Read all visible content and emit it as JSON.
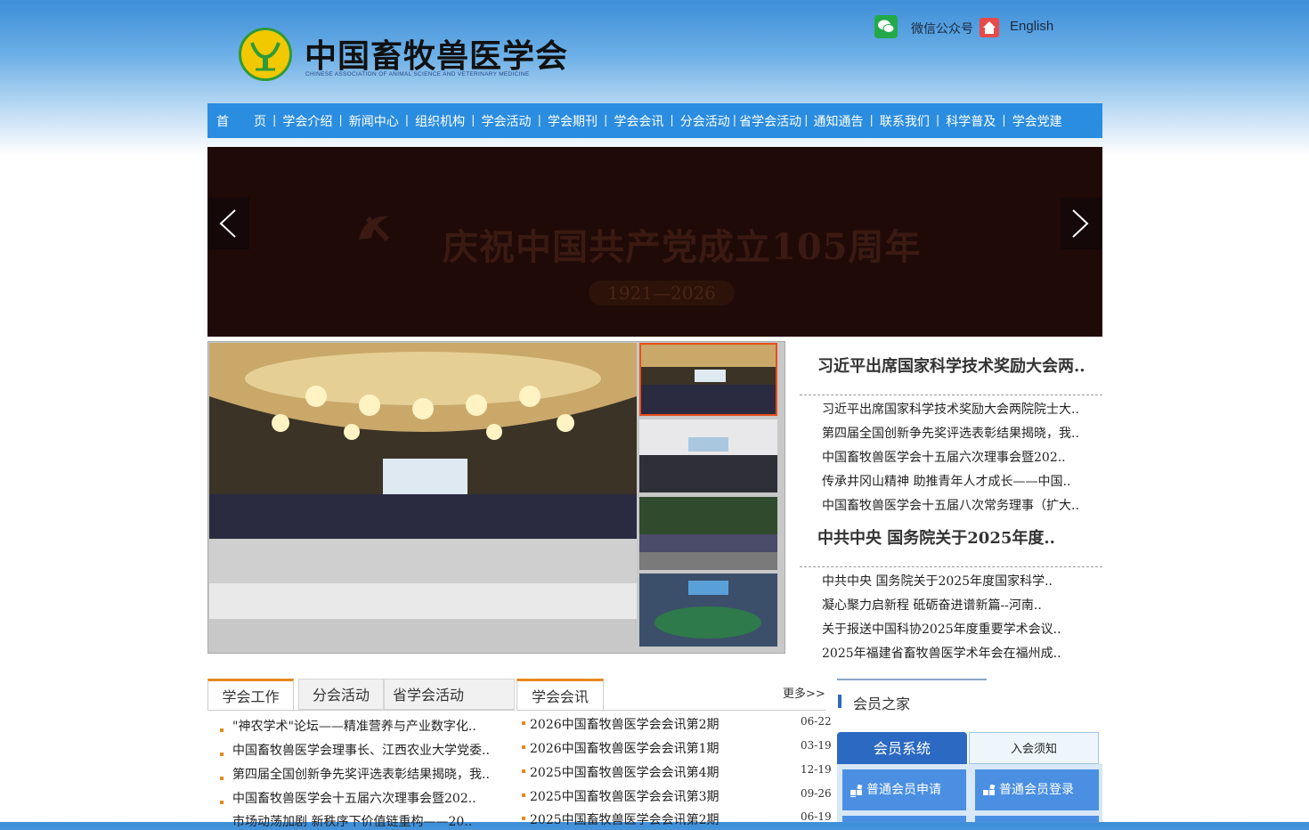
{
  "header": {
    "logo_cn": "中国畜牧兽医学会",
    "logo_en": "CHINESE ASSOCIATION OF ANIMAL SCIENCE AND VETERINARY MEDICINE",
    "wechat_label": "微信公众号",
    "english_label": "English",
    "icons": {
      "wechat": "wechat-icon",
      "home": "home-icon"
    }
  },
  "nav": {
    "items": [
      "首　　页",
      "学会介绍",
      "新闻中心",
      "组织机构",
      "学会活动",
      "学会期刊",
      "学会会讯",
      "分会活动",
      "省学会活动",
      "通知通告",
      "联系我们",
      "科学普及",
      "学会党建"
    ]
  },
  "banner": {
    "title": "庆祝中国共产党成立105周年",
    "years": "1921—2026",
    "icons": {
      "prev": "chevron-left-icon",
      "next": "chevron-right-icon"
    }
  },
  "news": {
    "groups": [
      {
        "headline": "习近平出席国家科学技术奖励大会两..",
        "items": [
          "习近平出席国家科学技术奖励大会两院院士大..",
          "第四届全国创新争先奖评选表彰结果揭晓，我..",
          "中国畜牧兽医学会十五届六次理事会暨202..",
          "传承井冈山精神 助推青年人才成长——中国..",
          "中国畜牧兽医学会十五届八次常务理事（扩大.."
        ]
      },
      {
        "headline": "中共中央 国务院关于2025年度..",
        "items": [
          "中共中央 国务院关于2025年度国家科学..",
          "凝心聚力启新程 砥砺奋进谱新篇--河南..",
          "关于报送中国科协2025年度重要学术会议..",
          "2025年福建省畜牧兽医学术年会在福州成.."
        ]
      }
    ]
  },
  "work": {
    "tabs": [
      "学会工作",
      "分会活动",
      "省学会活动"
    ],
    "items": [
      "\"神农学术\"论坛——精准营养与产业数字化..",
      "中国畜牧兽医学会理事长、江西农业大学党委..",
      "第四届全国创新争先奖评选表彰结果揭晓，我..",
      "中国畜牧兽医学会十五届六次理事会暨202..",
      "市场动荡加剧 新秩序下价值链重构——20.."
    ]
  },
  "newsletter": {
    "tab": "学会会讯",
    "more": "更多>>",
    "items": [
      {
        "title": "2026中国畜牧兽医学会会讯第2期",
        "date": "06-22"
      },
      {
        "title": "2026中国畜牧兽医学会会讯第1期",
        "date": "03-19"
      },
      {
        "title": "2025中国畜牧兽医学会会讯第4期",
        "date": "12-19"
      },
      {
        "title": "2025中国畜牧兽医学会会讯第3期",
        "date": "09-26"
      },
      {
        "title": "2025中国畜牧兽医学会会讯第2期",
        "date": "06-19"
      }
    ]
  },
  "member": {
    "title": "会员之家",
    "tab_system": "会员系统",
    "tab_notice": "入会须知",
    "btn_apply": "普通会员申请",
    "btn_login": "普通会员登录"
  },
  "colors": {
    "nav": "#2b8de0",
    "accent": "#e8891d",
    "member_blue": "#2b69c2",
    "banner_bg": "#1f0a08"
  }
}
